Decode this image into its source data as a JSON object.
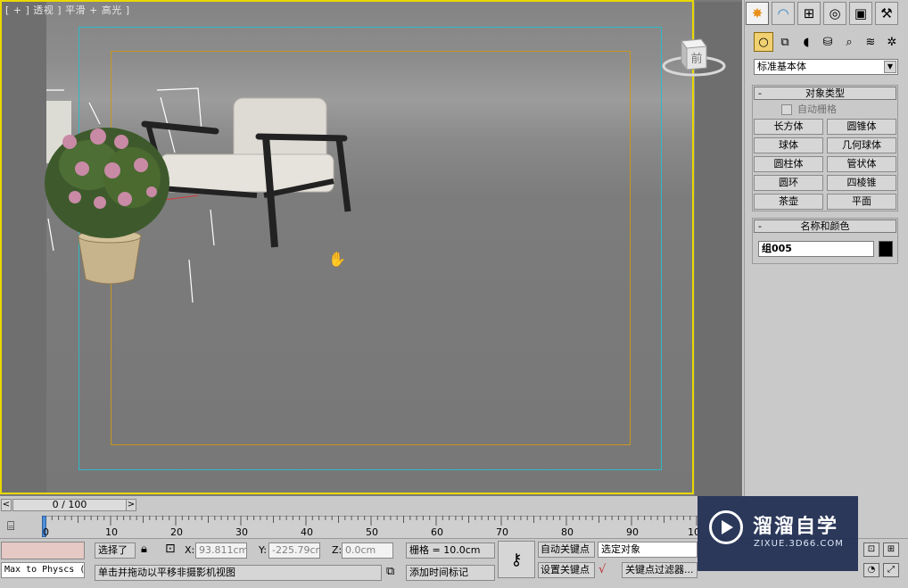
{
  "viewport": {
    "label": "[ + ] 透视 ] 平滑 + 高光 ]",
    "viewcube_face": "前",
    "border_color": "#e8d800",
    "frame_colors": {
      "safe_frame_outer": "#2fb8c8",
      "safe_frame_inner": "#c8961e"
    },
    "cursor_icon": "hand-pan-icon"
  },
  "command_panel": {
    "tabs": [
      {
        "name": "create",
        "icon": "sun-star-icon",
        "active": true
      },
      {
        "name": "modify",
        "icon": "bend-icon"
      },
      {
        "name": "hierarchy",
        "icon": "hierarchy-icon"
      },
      {
        "name": "motion",
        "icon": "motion-circle-icon"
      },
      {
        "name": "display",
        "icon": "monitor-icon"
      },
      {
        "name": "utilities",
        "icon": "hammer-icon"
      }
    ],
    "sub_tabs": [
      "geometry-sphere-icon",
      "shapes-icon",
      "lights-icon",
      "cameras-icon",
      "helpers-icon",
      "spacewarps-icon",
      "systems-icon"
    ],
    "category": "标准基本体",
    "object_type": {
      "title": "对象类型",
      "collapse": "-",
      "autogrid": "自动栅格",
      "buttons": [
        "长方体",
        "圆锥体",
        "球体",
        "几何球体",
        "圆柱体",
        "管状体",
        "圆环",
        "四棱锥",
        "茶壶",
        "平面"
      ]
    },
    "name_and_color": {
      "title": "名称和颜色",
      "collapse": "-",
      "name": "组005",
      "color": "#000000"
    }
  },
  "time_slider": {
    "prev": "<",
    "next": ">",
    "frame": "0 / 100"
  },
  "track": {
    "ticks": [
      "0",
      "10",
      "20",
      "30",
      "40",
      "50",
      "60",
      "70",
      "80",
      "90",
      "10"
    ]
  },
  "status": {
    "script_listener": "",
    "maxscript_line": "Max to Physcs (",
    "selection": "选择了",
    "x_label": "X:",
    "x_value": "93.811cm",
    "y_label": "Y:",
    "y_value": "-225.79cm",
    "z_label": "Z:",
    "z_value": "0.0cm",
    "grid": "栅格 = 10.0cm",
    "prompt": "单击并拖动以平移非摄影机视图",
    "add_time_tag": "添加时间标记",
    "auto_key": "自动关键点",
    "set_key": "设置关键点",
    "selected_object": "选定对象",
    "key_filter": "关键点过滤器..."
  },
  "watermark": {
    "title": "溜溜自学",
    "url": "ZIXUE.3D66.COM"
  }
}
